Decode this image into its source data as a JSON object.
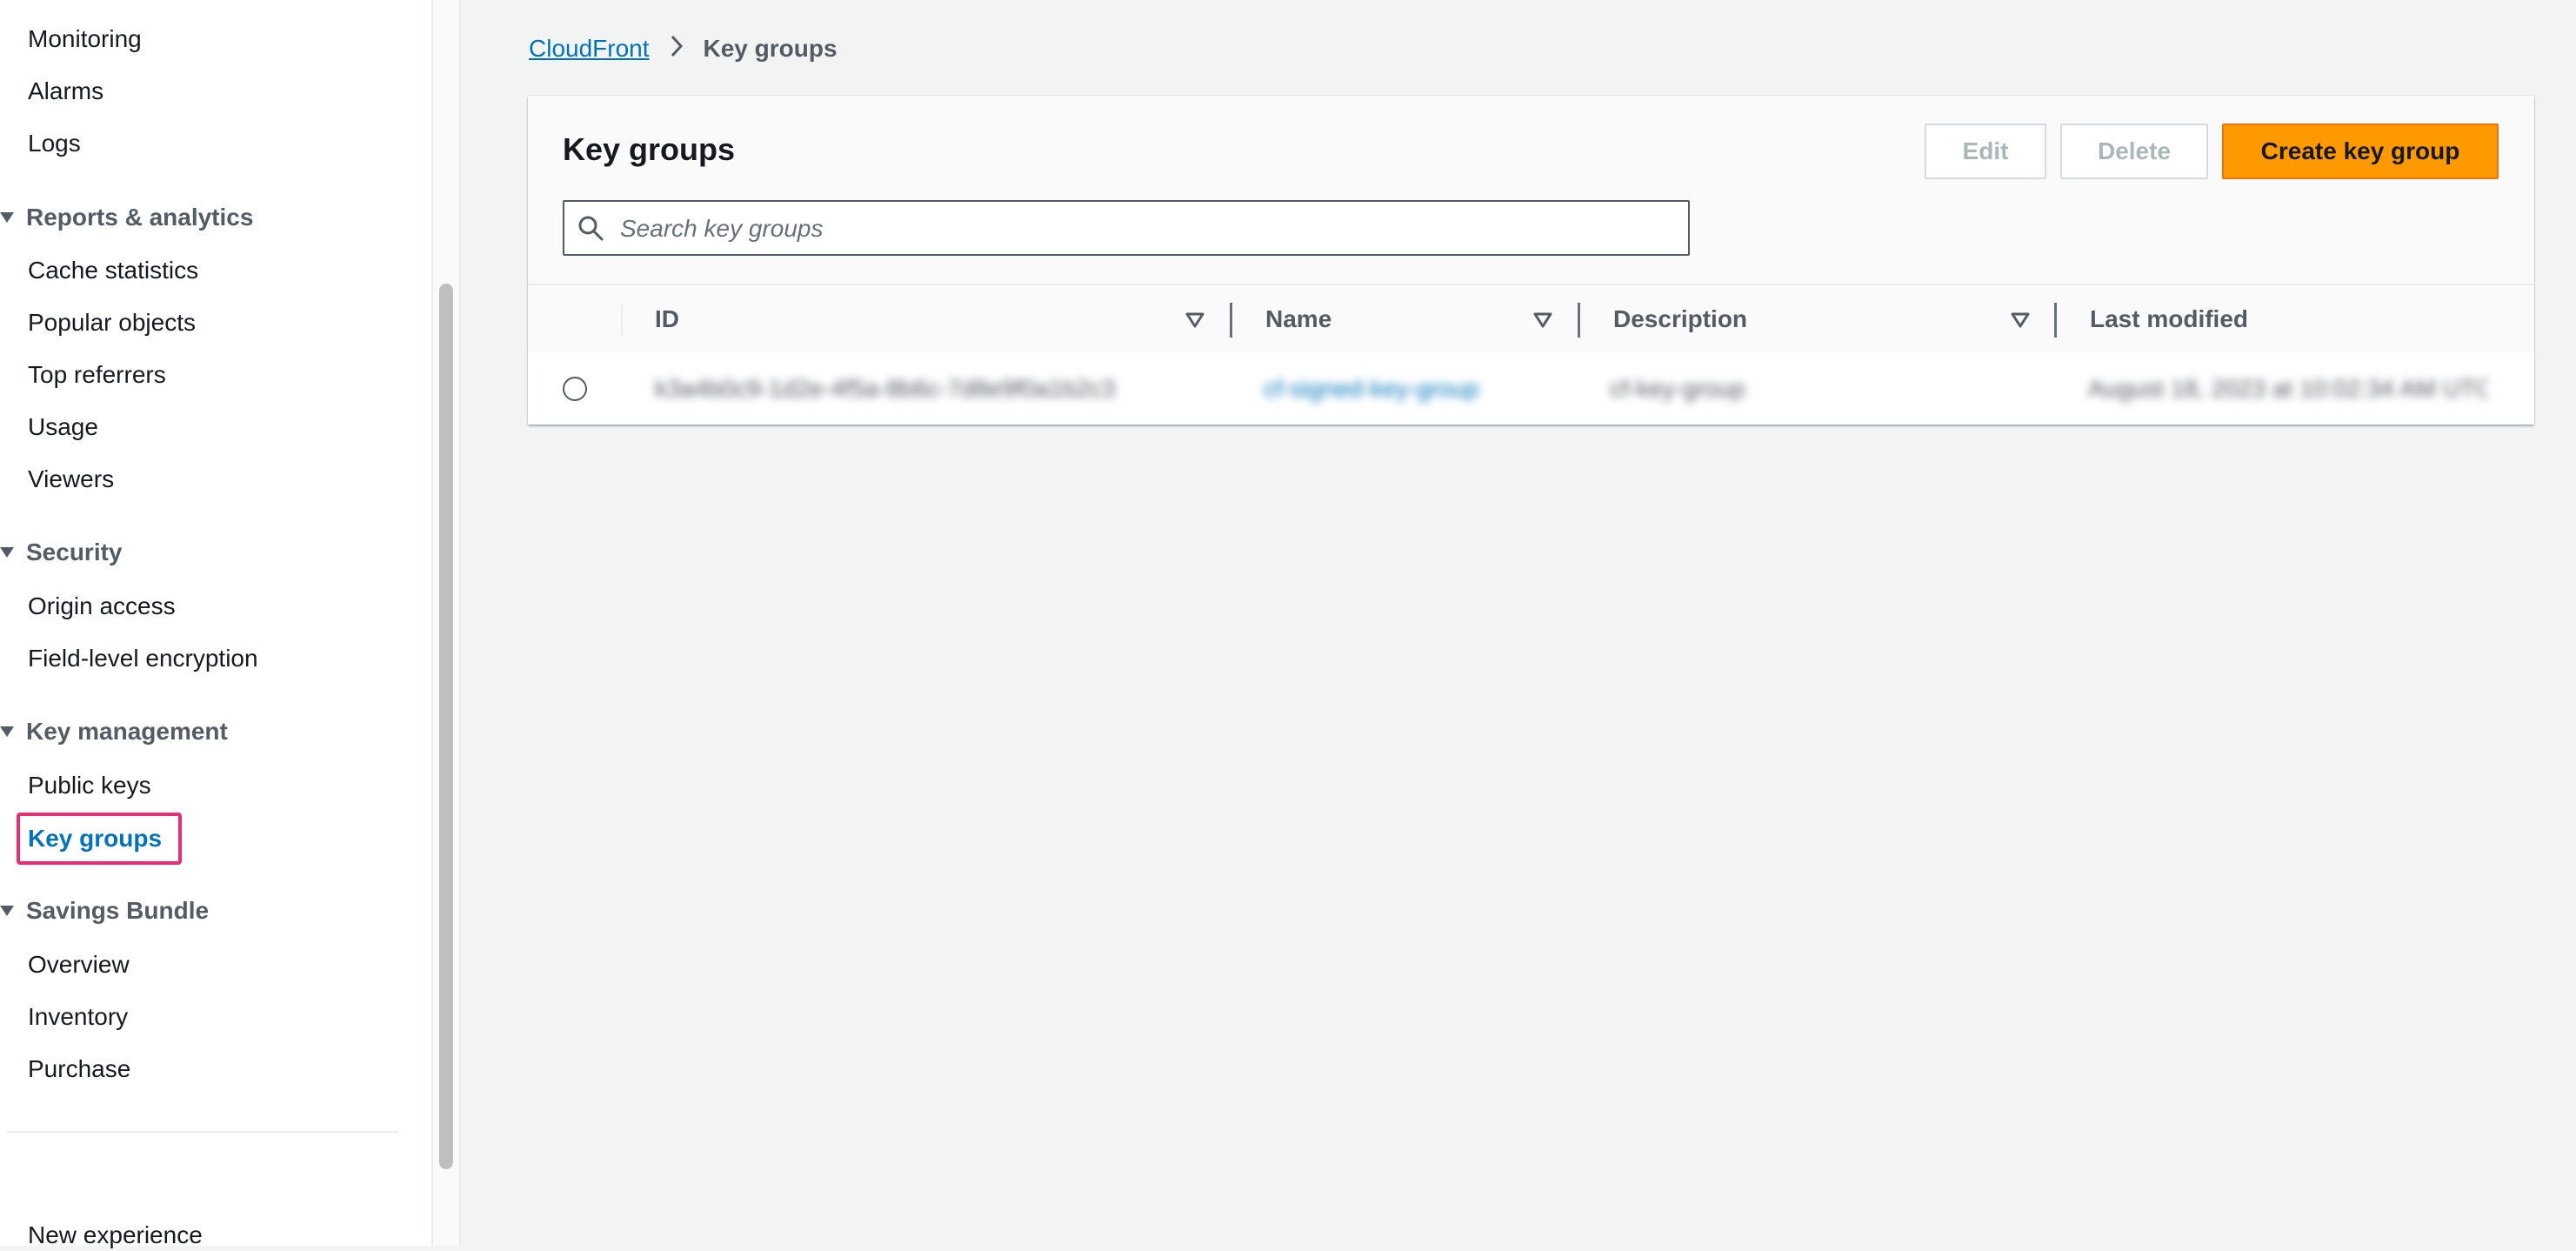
{
  "sidebar": {
    "items_top": [
      {
        "label": "Monitoring"
      },
      {
        "label": "Alarms"
      },
      {
        "label": "Logs"
      }
    ],
    "sections": [
      {
        "title": "Reports & analytics",
        "items": [
          "Cache statistics",
          "Popular objects",
          "Top referrers",
          "Usage",
          "Viewers"
        ]
      },
      {
        "title": "Security",
        "items": [
          "Origin access",
          "Field-level encryption"
        ]
      },
      {
        "title": "Key management",
        "items": [
          "Public keys",
          "Key groups"
        ]
      },
      {
        "title": "Savings Bundle",
        "items": [
          "Overview",
          "Inventory",
          "Purchase"
        ]
      }
    ],
    "active_item": "Key groups",
    "footer_label": "New experience"
  },
  "breadcrumb": {
    "root": "CloudFront",
    "current": "Key groups"
  },
  "panel": {
    "title": "Key groups",
    "buttons": {
      "edit": "Edit",
      "delete": "Delete",
      "create": "Create key group"
    },
    "search_placeholder": "Search key groups"
  },
  "table": {
    "columns": [
      "ID",
      "Name",
      "Description",
      "Last modified"
    ],
    "rows": [
      {
        "id": "k3a4b0c9-1d2e-4f5a-8b6c-7d8e9f0a1b2c3",
        "name": "cf-signed-key-group",
        "description": "cf-key-group",
        "last_modified": "August 18, 2023 at 10:02:34 AM UTC"
      }
    ]
  },
  "colors": {
    "accent": "#0073bb",
    "primary_button": "#ff9900",
    "highlight_box": "#e62e75"
  }
}
